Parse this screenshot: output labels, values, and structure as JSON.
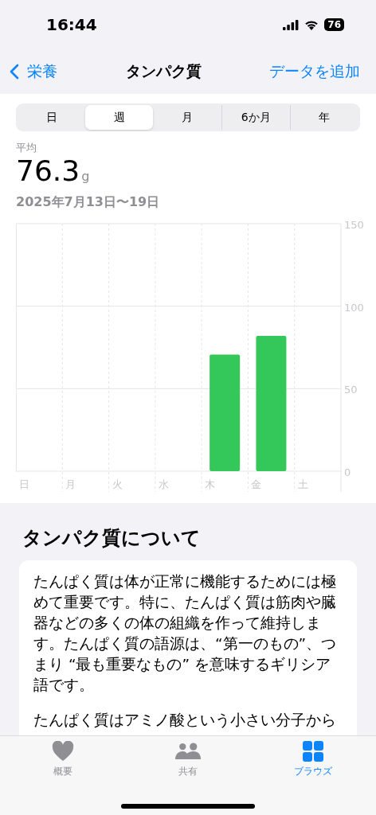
{
  "status_bar": {
    "time": "16:44",
    "battery": "76"
  },
  "nav": {
    "back": "栄養",
    "title": "タンパク質",
    "action": "データを追加"
  },
  "segments": [
    {
      "label": "日",
      "selected": false
    },
    {
      "label": "週",
      "selected": true
    },
    {
      "label": "月",
      "selected": false
    },
    {
      "label": "6か月",
      "selected": false
    },
    {
      "label": "年",
      "selected": false
    }
  ],
  "summary": {
    "label": "平均",
    "value": "76.3",
    "unit": "g",
    "range": "2025年7月13日〜19日"
  },
  "chart_data": {
    "type": "bar",
    "categories": [
      "日",
      "月",
      "火",
      "水",
      "木",
      "金",
      "土"
    ],
    "series": [
      {
        "color": "#34c759",
        "values": [
          null,
          null,
          null,
          null,
          70.6,
          82.0,
          null
        ]
      }
    ],
    "ylim": [
      0,
      150
    ],
    "yticks": [
      0,
      50,
      100,
      150
    ]
  },
  "about": {
    "title": "タンパク質について",
    "paragraphs": [
      "たんぱく質は体が正常に機能するためには極めて重要です。特に、たんぱく質は筋肉や臓器などの多くの体の組織を作って維持します。たんぱく質の語源は、“第一のもの”、つまり “最も重要なもの” を意味するギリシア語です。",
      "たんぱく質はアミノ酸という小さい分子から"
    ]
  },
  "tab_bar": [
    {
      "label": "概要",
      "kind": "heart",
      "selected": false
    },
    {
      "label": "共有",
      "kind": "people",
      "selected": false
    },
    {
      "label": "ブラウズ",
      "kind": "grid",
      "selected": true
    }
  ]
}
